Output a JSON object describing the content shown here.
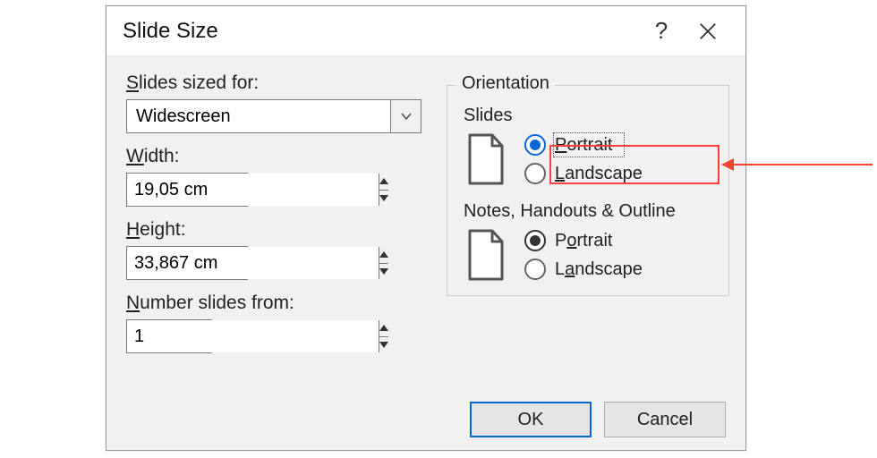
{
  "dialog": {
    "title": "Slide Size",
    "help_tooltip": "?",
    "left": {
      "sized_for_label": "Slides sized for:",
      "sized_for_value": "Widescreen",
      "width_label": "Width:",
      "width_value": "19,05 cm",
      "height_label": "Height:",
      "height_value": "33,867 cm",
      "number_label": "Number slides from:",
      "number_value": "1"
    },
    "orientation": {
      "group_label": "Orientation",
      "slides": {
        "label": "Slides",
        "portrait": "Portrait",
        "landscape": "Landscape",
        "selected": "portrait"
      },
      "notes": {
        "label": "Notes, Handouts & Outline",
        "portrait": "Portrait",
        "landscape": "Landscape",
        "selected": "portrait"
      }
    },
    "buttons": {
      "ok": "OK",
      "cancel": "Cancel"
    }
  },
  "annotation": {
    "color": "#f44336"
  }
}
